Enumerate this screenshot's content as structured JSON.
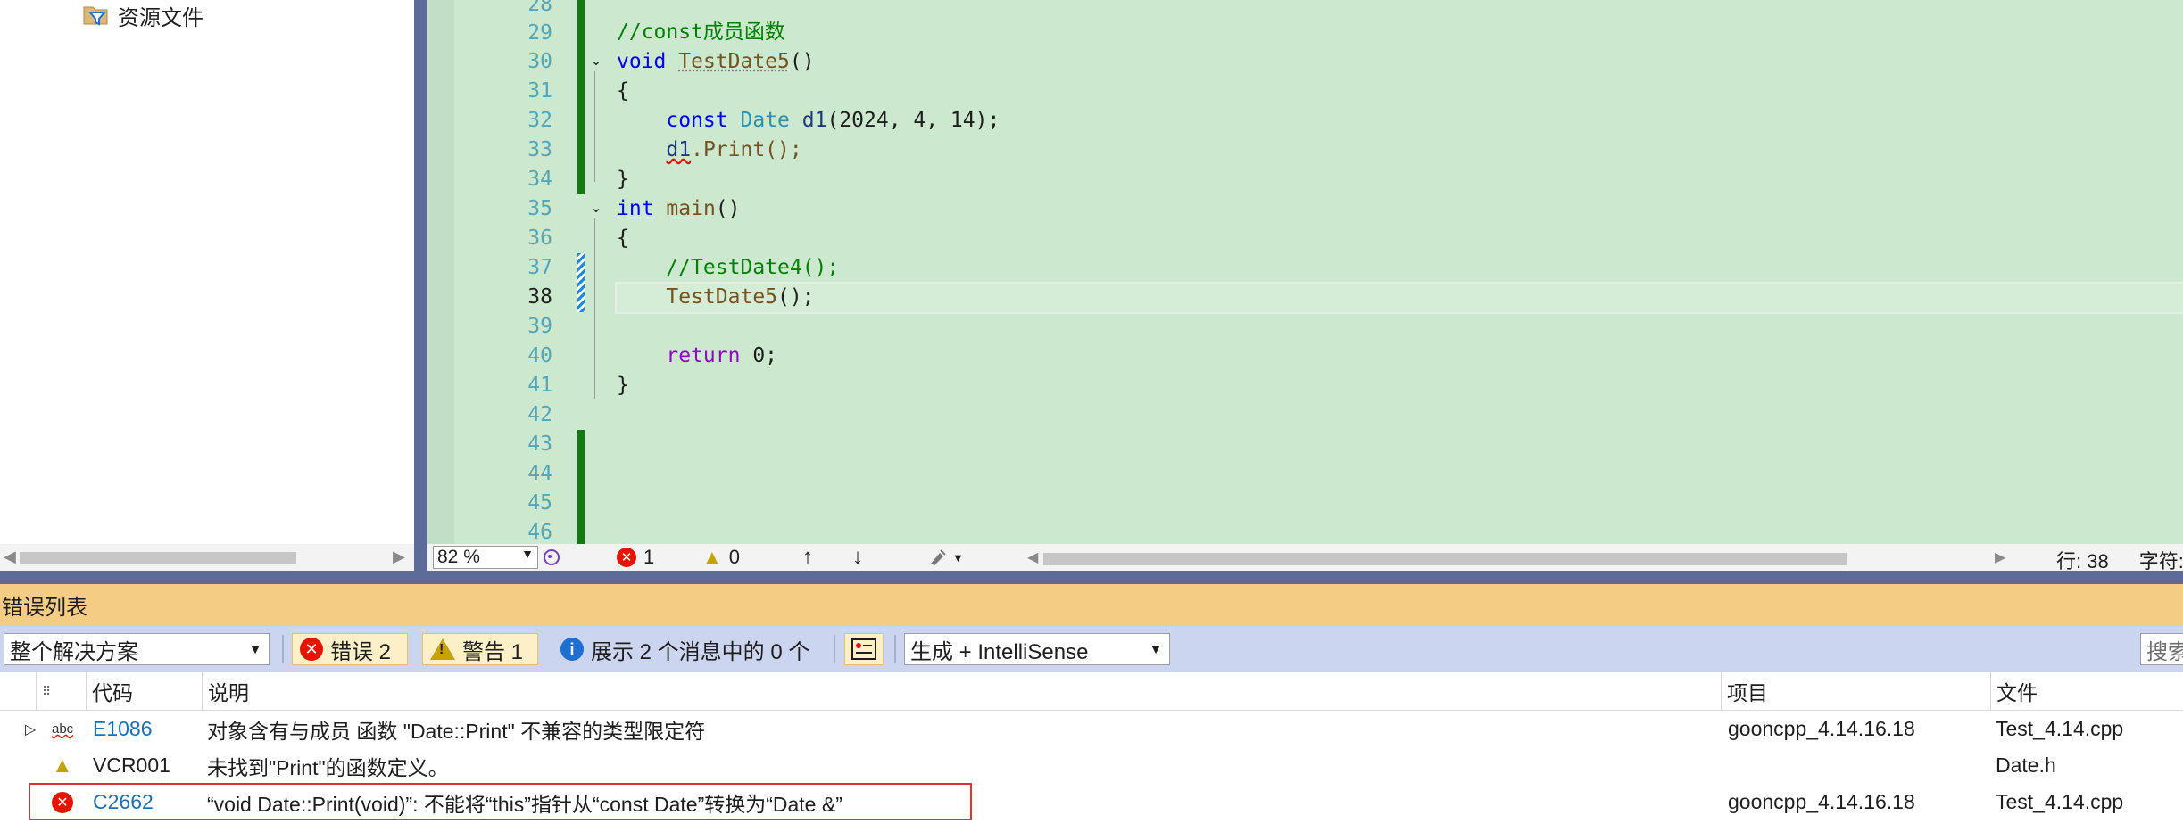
{
  "solution_explorer": {
    "item_label": "资源文件"
  },
  "editor": {
    "lines": [
      {
        "num": "28"
      },
      {
        "num": "29"
      },
      {
        "num": "30"
      },
      {
        "num": "31"
      },
      {
        "num": "32"
      },
      {
        "num": "33"
      },
      {
        "num": "34"
      },
      {
        "num": "35"
      },
      {
        "num": "36"
      },
      {
        "num": "37"
      },
      {
        "num": "38"
      },
      {
        "num": "39"
      },
      {
        "num": "40"
      },
      {
        "num": "41"
      },
      {
        "num": "42"
      },
      {
        "num": "43"
      },
      {
        "num": "44"
      },
      {
        "num": "45"
      },
      {
        "num": "46"
      }
    ],
    "code": {
      "l29": "//const成员函数",
      "l30_kw": "void",
      "l30_fn": "TestDate5",
      "l30_rest": "()",
      "l31": "{",
      "l32_kw": "const",
      "l32_ty": "Date",
      "l32_var": "d1",
      "l32_rest": "(2024, 4, 14);",
      "l33_var": "d1",
      "l33_rest": ".Print();",
      "l34": "}",
      "l35_kw": "int",
      "l35_fn": "main",
      "l35_rest": "()",
      "l36": "{",
      "l37": "//TestDate4();",
      "l38_fn": "TestDate5",
      "l38_rest": "();",
      "l40_kw": "return",
      "l40_rest": " 0;",
      "l41": "}"
    },
    "status": {
      "zoom": "82 %",
      "error_count": "1",
      "warning_count": "0",
      "position": "行: 38",
      "position_more": "字符:"
    }
  },
  "error_list": {
    "title": "错误列表",
    "scope": "整个解决方案",
    "errors_label": "错误 2",
    "warnings_label": "警告 1",
    "messages_label": "展示 2 个消息中的 0 个",
    "build_filter": "生成 + IntelliSense",
    "search_placeholder": "搜索",
    "columns": {
      "code": "代码",
      "description": "说明",
      "project": "项目",
      "file": "文件"
    },
    "rows": [
      {
        "code": "E1086",
        "description": "对象含有与成员 函数 \"Date::Print\" 不兼容的类型限定符",
        "project": "gooncpp_4.14.16.18",
        "file": "Test_4.14.cpp"
      },
      {
        "code": "VCR001",
        "description": "未找到\"Print\"的函数定义。",
        "project": "",
        "file": "Date.h"
      },
      {
        "code": "C2662",
        "description": "“void Date::Print(void)”: 不能将“this”指针从“const Date”转换为“Date &”",
        "project": "gooncpp_4.14.16.18",
        "file": "Test_4.14.cpp"
      }
    ]
  }
}
